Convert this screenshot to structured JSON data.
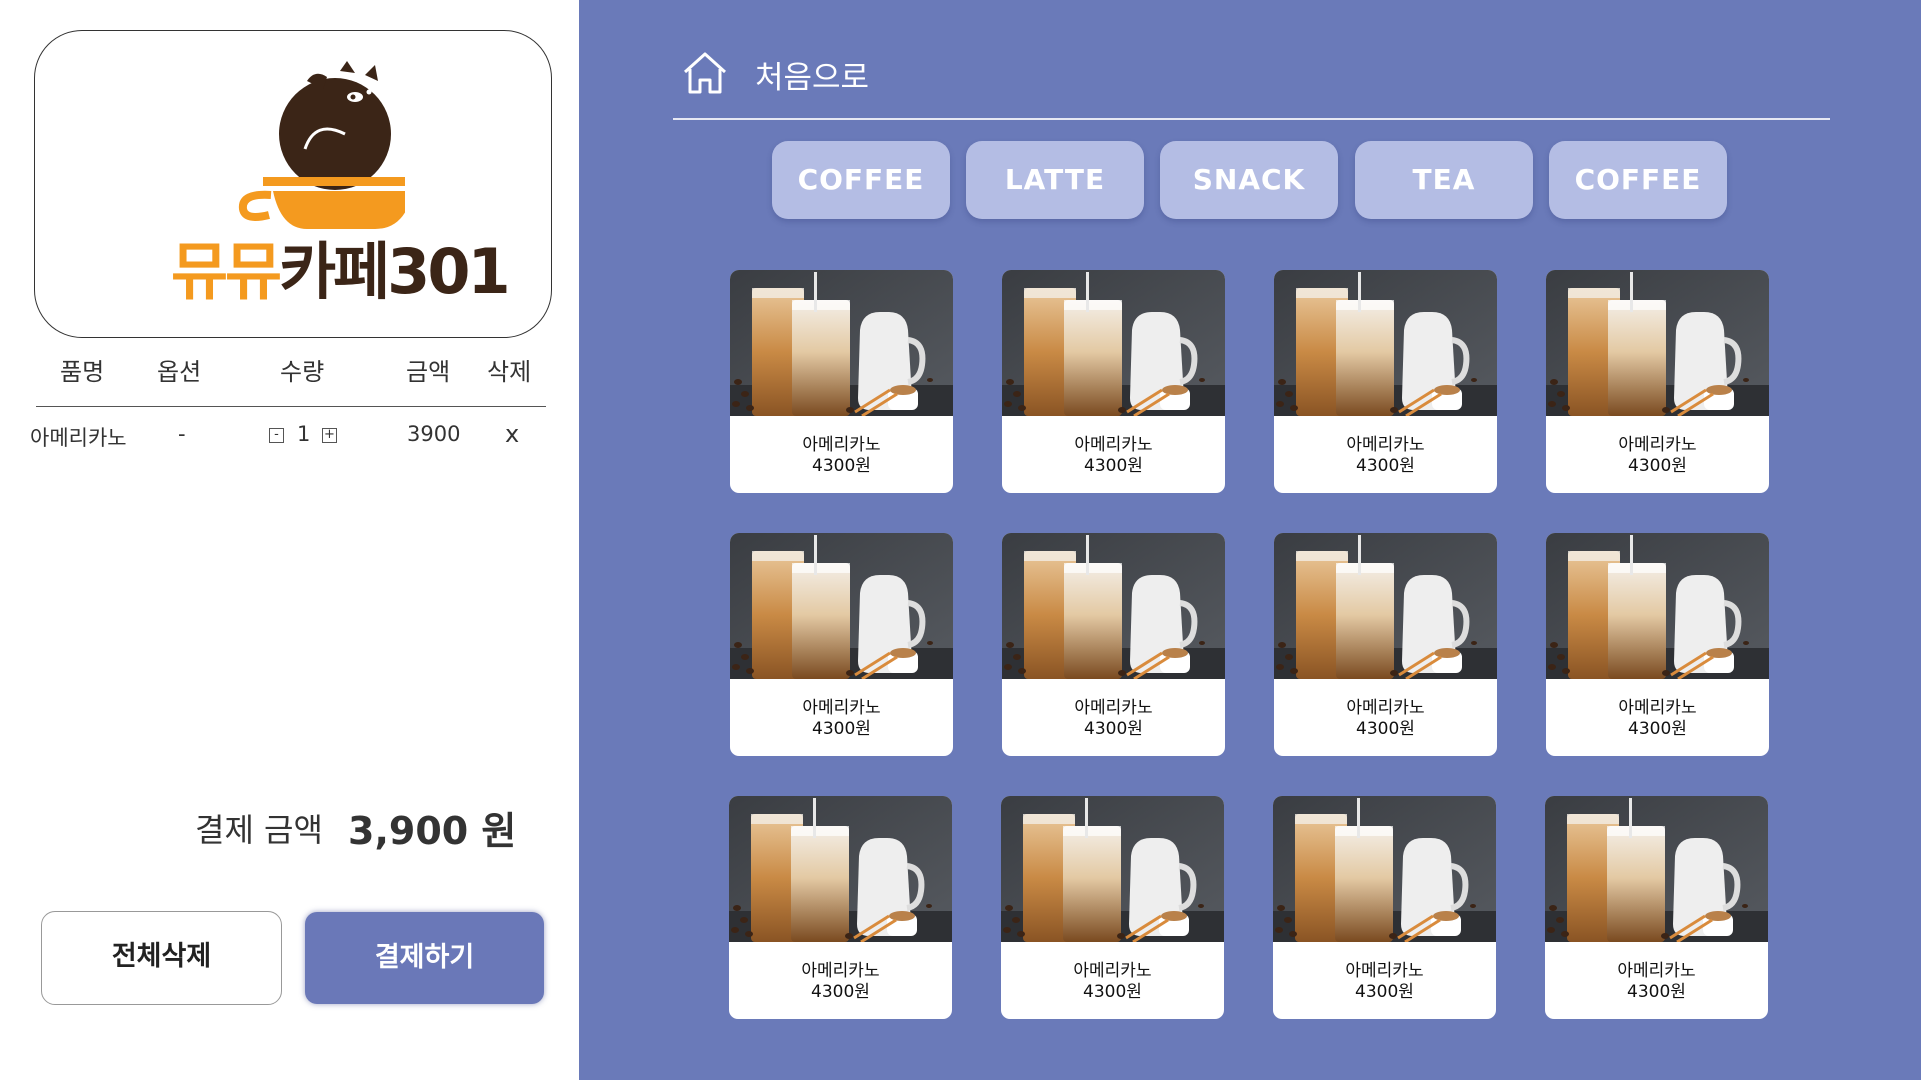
{
  "brand": {
    "name_orange": "뮤뮤",
    "name_dark": "카페301"
  },
  "cart": {
    "headers": {
      "name": "품명",
      "option": "옵션",
      "qty": "수량",
      "price": "금액",
      "delete": "삭제"
    },
    "items": [
      {
        "name": "아메리카노",
        "option": "-",
        "qty": "1",
        "price": "3900",
        "delete": "x"
      }
    ],
    "minus": "-",
    "plus": "+"
  },
  "total": {
    "label": "결제 금액",
    "value": "3,900 원"
  },
  "buttons": {
    "clear": "전체삭제",
    "pay": "결제하기"
  },
  "nav": {
    "home": "처음으로",
    "home_icon": "home-icon"
  },
  "tabs": [
    "COFFEE",
    "LATTE",
    "SNACK",
    "TEA",
    "COFFEE"
  ],
  "menu": [
    {
      "name": "아메리카노",
      "price": "4300원"
    },
    {
      "name": "아메리카노",
      "price": "4300원"
    },
    {
      "name": "아메리카노",
      "price": "4300원"
    },
    {
      "name": "아메리카노",
      "price": "4300원"
    },
    {
      "name": "아메리카노",
      "price": "4300원"
    },
    {
      "name": "아메리카노",
      "price": "4300원"
    },
    {
      "name": "아메리카노",
      "price": "4300원"
    },
    {
      "name": "아메리카노",
      "price": "4300원"
    },
    {
      "name": "아메리카노",
      "price": "4300원"
    },
    {
      "name": "아메리카노",
      "price": "4300원"
    },
    {
      "name": "아메리카노",
      "price": "4300원"
    },
    {
      "name": "아메리카노",
      "price": "4300원"
    }
  ],
  "colors": {
    "panel": "#6a7ab9",
    "tab": "#b4bde4",
    "accent_orange": "#f49a1f",
    "logo_dark": "#3b2517"
  }
}
